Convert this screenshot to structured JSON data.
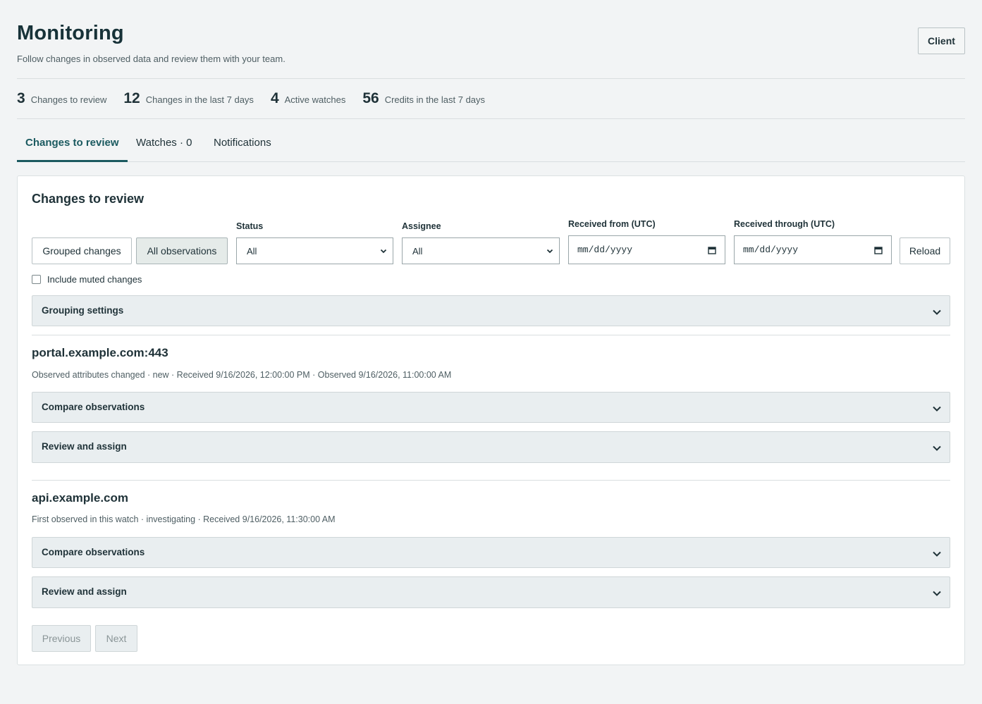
{
  "header": {
    "title": "Monitoring",
    "subtitle": "Follow changes in observed data and review them with your team.",
    "client_button": "Client"
  },
  "stats": [
    {
      "value": "3",
      "label": "Changes to review"
    },
    {
      "value": "12",
      "label": "Changes in the last 7 days"
    },
    {
      "value": "4",
      "label": "Active watches"
    },
    {
      "value": "56",
      "label": "Credits in the last 7 days"
    }
  ],
  "tabs": [
    {
      "label": "Changes to review",
      "active": true
    },
    {
      "label": "Watches · 0",
      "active": false
    },
    {
      "label": "Notifications",
      "active": false
    }
  ],
  "panel": {
    "title": "Changes to review",
    "view_buttons": {
      "grouped": "Grouped changes",
      "all": "All observations"
    },
    "filters": {
      "status_label": "Status",
      "status_value": "All",
      "assignee_label": "Assignee",
      "assignee_value": "All",
      "from_label": "Received from (UTC)",
      "from_placeholder": "mm/dd/yyyy",
      "through_label": "Received through (UTC)",
      "through_placeholder": "mm/dd/yyyy",
      "reload": "Reload"
    },
    "include_muted": "Include muted changes",
    "grouping_settings": "Grouping settings",
    "changes": [
      {
        "host": "portal.example.com:443",
        "meta": "Observed attributes changed · new · Received 9/16/2026, 12:00:00 PM · Observed 9/16/2026, 11:00:00 AM",
        "compare": "Compare observations",
        "review": "Review and assign"
      },
      {
        "host": "api.example.com",
        "meta": "First observed in this watch · investigating · Received 9/16/2026, 11:30:00 AM",
        "compare": "Compare observations",
        "review": "Review and assign"
      }
    ],
    "pager": {
      "previous": "Previous",
      "next": "Next"
    }
  },
  "colors": {
    "accent": "#1b5a60",
    "background": "#f2f4f5",
    "accordion": "#e9eef0"
  }
}
